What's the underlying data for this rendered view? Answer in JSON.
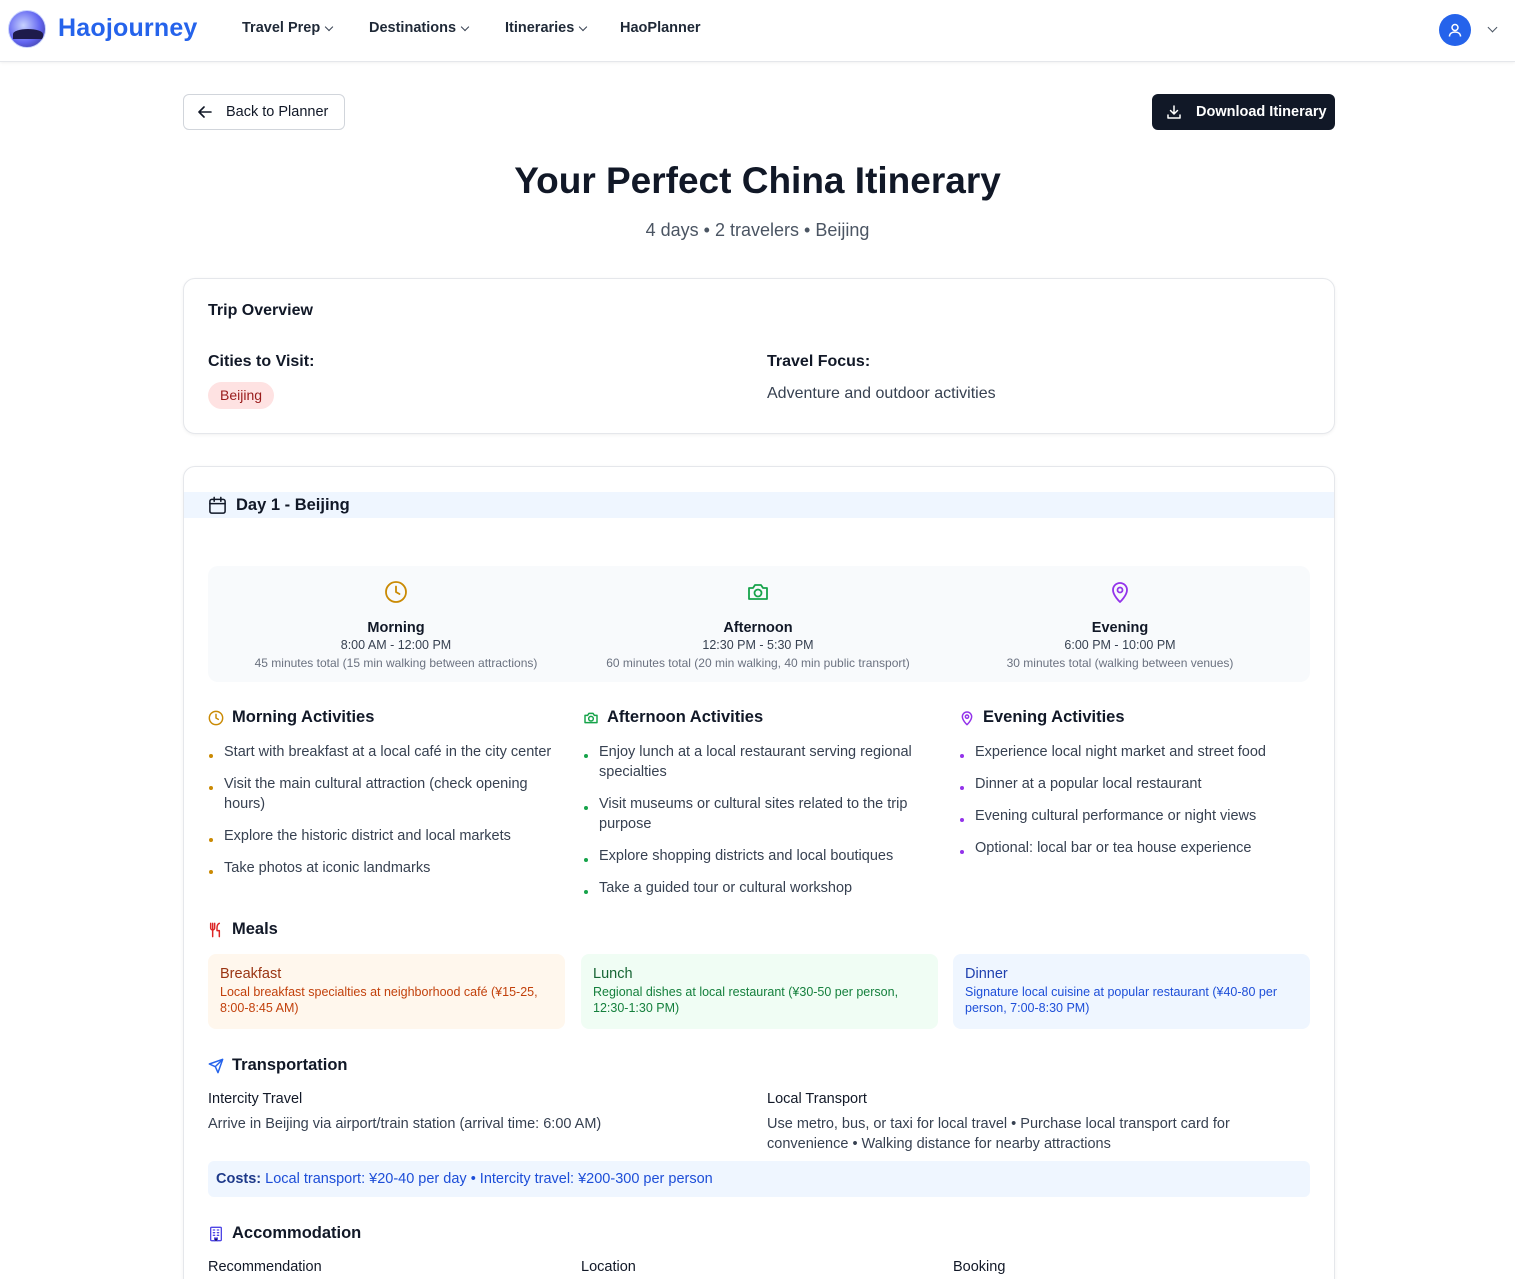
{
  "header": {
    "brand": "Haojourney",
    "nav": [
      {
        "label": "Travel Prep",
        "has_dropdown": true
      },
      {
        "label": "Destinations",
        "has_dropdown": true
      },
      {
        "label": "Itineraries",
        "has_dropdown": true
      },
      {
        "label": "HaoPlanner",
        "has_dropdown": false
      }
    ],
    "avatar_icon": "user-icon",
    "accent_color": "#2563eb"
  },
  "actions": {
    "back_label": "Back to Planner",
    "download_label": "Download Itinerary"
  },
  "title": "Your Perfect China Itinerary",
  "subtitle": "4 days • 2 travelers • Beijing",
  "overview": {
    "title": "Trip Overview",
    "cities_label": "Cities to Visit:",
    "cities": [
      "Beijing"
    ],
    "focus_label": "Travel Focus:",
    "focus": "Adventure and outdoor activities"
  },
  "day": {
    "title": "Day 1 - Beijing",
    "times": [
      {
        "name": "Morning",
        "range": "8:00 AM - 12:00 PM",
        "note": "45 minutes total (15 min walking between attractions)",
        "icon": "clock-icon",
        "color": "#ca8a04"
      },
      {
        "name": "Afternoon",
        "range": "12:30 PM - 5:30 PM",
        "note": "60 minutes total (20 min walking, 40 min public transport)",
        "icon": "camera-icon",
        "color": "#16a34a"
      },
      {
        "name": "Evening",
        "range": "6:00 PM - 10:00 PM",
        "note": "30 minutes total (walking between venues)",
        "icon": "map-pin-icon",
        "color": "#9333ea"
      }
    ],
    "activities": [
      {
        "heading": "Morning Activities",
        "color": "#ca8a04",
        "items": [
          "Start with breakfast at a local café in the city center",
          "Visit the main cultural attraction (check opening hours)",
          "Explore the historic district and local markets",
          "Take photos at iconic landmarks"
        ]
      },
      {
        "heading": "Afternoon Activities",
        "color": "#16a34a",
        "items": [
          "Enjoy lunch at a local restaurant serving regional specialties",
          "Visit museums or cultural sites related to the trip purpose",
          "Explore shopping districts and local boutiques",
          "Take a guided tour or cultural workshop"
        ]
      },
      {
        "heading": "Evening Activities",
        "color": "#9333ea",
        "items": [
          "Experience local night market and street food",
          "Dinner at a popular local restaurant",
          "Evening cultural performance or night views",
          "Optional: local bar or tea house experience"
        ]
      }
    ],
    "meals_heading": "Meals",
    "meals": [
      {
        "name": "Breakfast",
        "desc": "Local breakfast specialties at neighborhood café (¥15-25, 8:00-8:45 AM)",
        "bg": "#fff7ed",
        "fg": "#c2410c",
        "title_fg": "#9a3412"
      },
      {
        "name": "Lunch",
        "desc": "Regional dishes at local restaurant (¥30-50 per person, 12:30-1:30 PM)",
        "bg": "#f0fdf4",
        "fg": "#15803d",
        "title_fg": "#166534"
      },
      {
        "name": "Dinner",
        "desc": "Signature local cuisine at popular restaurant (¥40-80 per person, 7:00-8:30 PM)",
        "bg": "#eff6ff",
        "fg": "#1d4ed8",
        "title_fg": "#1e40af"
      }
    ],
    "transport": {
      "heading": "Transportation",
      "intercity_label": "Intercity Travel",
      "intercity_text": "Arrive in Beijing via airport/train station (arrival time: 6:00 AM)",
      "local_label": "Local Transport",
      "local_text": "Use metro, bus, or taxi for local travel • Purchase local transport card for convenience • Walking distance for nearby attractions",
      "costs_label": "Costs:",
      "costs_text": "Local transport: ¥20-40 per day • Intercity travel: ¥200-300 per person"
    },
    "accommodation": {
      "heading": "Accommodation",
      "labels": [
        "Recommendation",
        "Location",
        "Booking"
      ]
    }
  }
}
